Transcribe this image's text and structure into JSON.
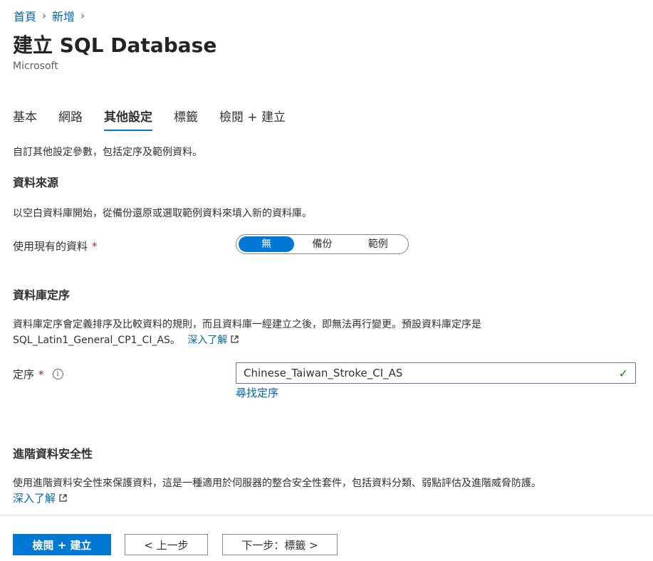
{
  "breadcrumb": {
    "items": [
      "首頁",
      "新增"
    ],
    "separator": "›"
  },
  "page": {
    "title": "建立 SQL Database",
    "subtitle": "Microsoft"
  },
  "tabs": [
    {
      "label": "基本",
      "active": false
    },
    {
      "label": "網路",
      "active": false
    },
    {
      "label": "其他設定",
      "active": true
    },
    {
      "label": "標籤",
      "active": false
    },
    {
      "label": "檢閱 + 建立",
      "active": false
    }
  ],
  "intro": "自訂其他設定參數，包括定序及範例資料。",
  "data_source": {
    "heading": "資料來源",
    "description": "以空白資料庫開始，從備份還原或選取範例資料來填入新的資料庫。",
    "field_label": "使用現有的資料",
    "required_mark": "*",
    "options": [
      "無",
      "備份",
      "範例"
    ],
    "selected": "無"
  },
  "collation": {
    "heading": "資料庫定序",
    "description_line1": "資料庫定序會定義排序及比較資料的規則，而且資料庫一經建立之後，即無法再行變更。預設資料庫定序是",
    "description_line2": "SQL_Latin1_General_CP1_CI_AS。",
    "learn_more": "深入了解",
    "field_label": "定序",
    "required_mark": "*",
    "info_icon": "i",
    "value": "Chinese_Taiwan_Stroke_CI_AS",
    "valid_icon": "✓",
    "find_link": "尋找定序"
  },
  "advanced_security": {
    "heading": "進階資料安全性",
    "description": "使用進階資料安全性來保護資料，這是一種適用於伺服器的整合安全性套件，包括資料分類、弱點評估及進階威脅防護。",
    "learn_more": "深入了解"
  },
  "footer": {
    "primary": "檢閱 + 建立",
    "previous": "< 上一步",
    "next": "下一步：標籤 >"
  },
  "icons": {
    "external_link": "external-link-icon",
    "chevron": "chevron-right-icon"
  },
  "colors": {
    "accent": "#0078d4",
    "link": "#0067b8",
    "required": "#a4262c",
    "valid": "#107c10",
    "input_border": "#8764b8"
  }
}
